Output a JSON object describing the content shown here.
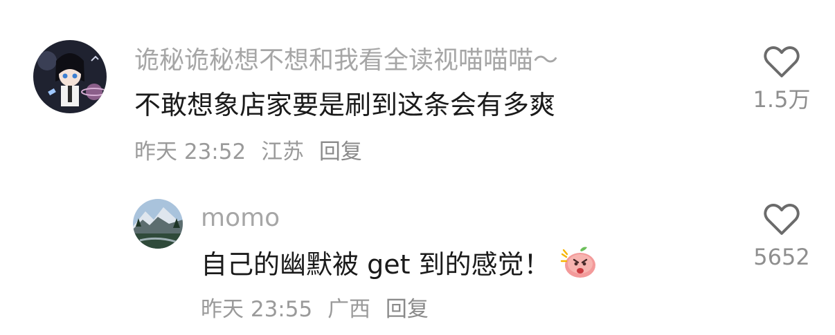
{
  "comments": [
    {
      "username": "诡秘诡秘想不想和我看全读视喵喵喵～",
      "text": "不敢想象店家要是刷到这条会有多爽",
      "time": "昨天 23:52",
      "location": "江苏",
      "reply_label": "回复",
      "likes": "1.5万",
      "avatar_icon": "anime-character-avatar"
    },
    {
      "username": "momo",
      "text": "自己的幽默被 get 到的感觉！",
      "emoji": "shocked-peach-emoji",
      "time": "昨天 23:55",
      "location": "广西",
      "reply_label": "回复",
      "likes": "5652",
      "avatar_icon": "mountain-landscape-avatar"
    }
  ],
  "colors": {
    "username": "#a6a6a6",
    "text": "#1a1a1a",
    "meta": "#9a9a9a",
    "heart_outline": "#6b6b6b"
  }
}
